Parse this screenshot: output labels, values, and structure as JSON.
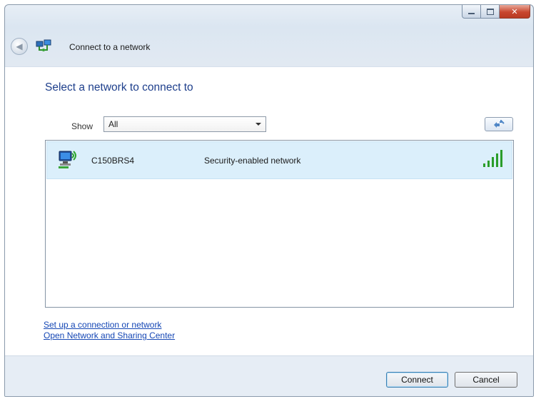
{
  "window": {
    "title": "Connect to a network",
    "caption_buttons": [
      "minimize-icon",
      "maximize-icon",
      "close-icon"
    ],
    "close_glyph": "✕"
  },
  "header": {
    "back_icon": "back-arrow-icon",
    "app_icon": "network-connect-icon"
  },
  "main": {
    "heading": "Select a network to connect to",
    "show_label": "Show",
    "show_value": "All",
    "refresh_icon": "refresh-icon",
    "networks": [
      {
        "name": "C150BRS4",
        "security": "Security-enabled network",
        "icon": "wireless-computer-icon",
        "signal_icon": "signal-strength-icon",
        "signal_bars": 5,
        "selected": true
      }
    ],
    "links": [
      "Set up a connection or network",
      "Open Network and Sharing Center"
    ]
  },
  "footer": {
    "connect_label": "Connect",
    "cancel_label": "Cancel"
  },
  "colors": {
    "heading": "#1e3f8c",
    "link": "#1547b5",
    "selection": "#dbeffb",
    "signal": "#2a9d2a"
  }
}
